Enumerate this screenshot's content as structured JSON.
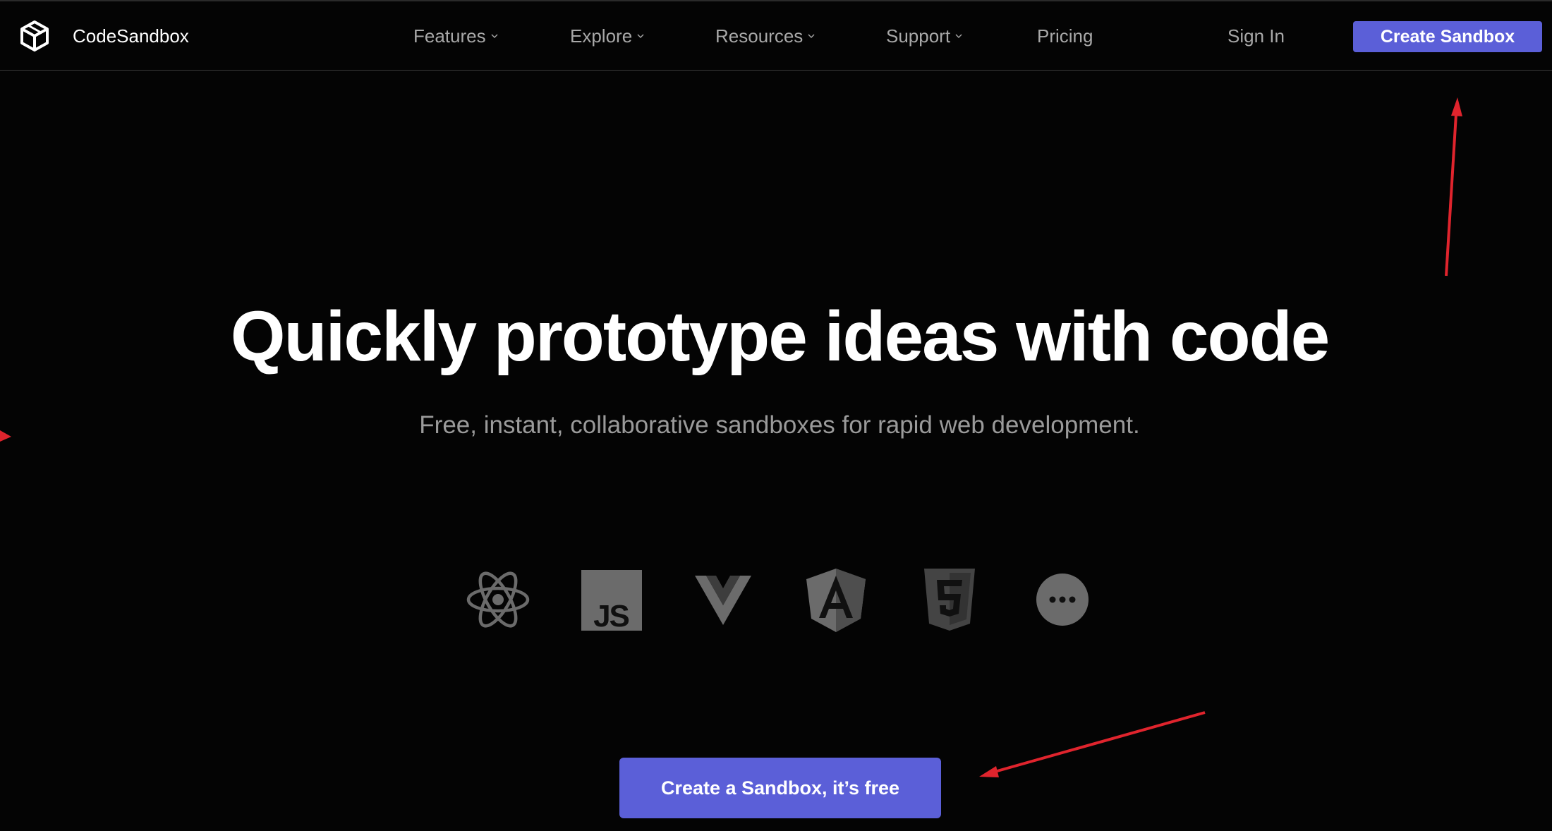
{
  "header": {
    "brand": "CodeSandbox",
    "nav": [
      {
        "label": "Features",
        "has_dropdown": true
      },
      {
        "label": "Explore",
        "has_dropdown": true
      },
      {
        "label": "Resources",
        "has_dropdown": true
      },
      {
        "label": "Support",
        "has_dropdown": true
      },
      {
        "label": "Pricing",
        "has_dropdown": false
      }
    ],
    "sign_in": "Sign In",
    "create_sandbox": "Create Sandbox"
  },
  "hero": {
    "title": "Quickly prototype ideas with code",
    "subtitle": "Free, instant, collaborative sandboxes for rapid web development.",
    "frameworks": [
      "react-icon",
      "javascript-icon",
      "vue-icon",
      "angular-icon",
      "html5-icon",
      "more-icon"
    ],
    "js_label": "JS",
    "cta": "Create a Sandbox, it’s free"
  },
  "colors": {
    "background": "#040404",
    "accent": "#5b5fd8",
    "nav_text": "#a8a8a8",
    "icon_gray": "#6b6b6b",
    "annotation_red": "#e0242d"
  }
}
